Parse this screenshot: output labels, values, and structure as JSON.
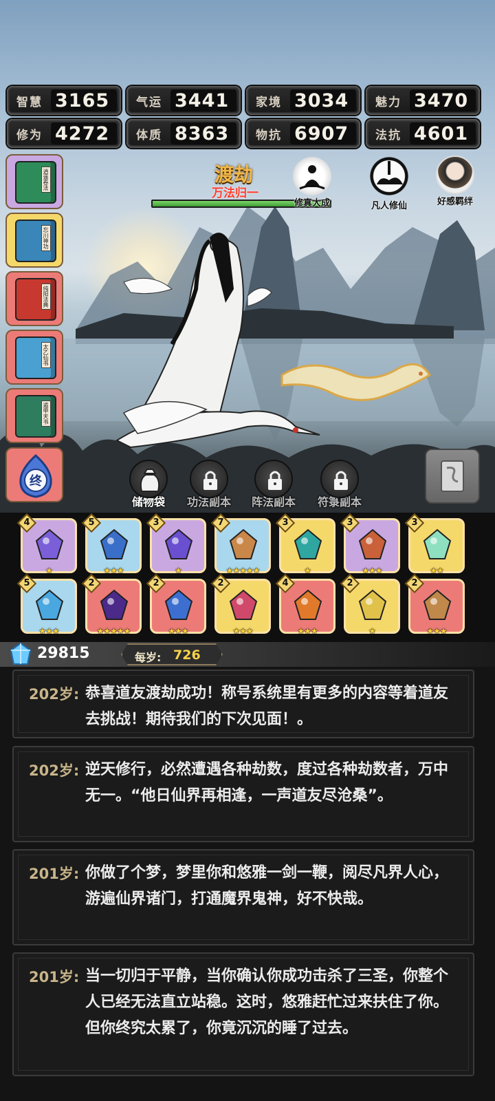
{
  "stats": [
    {
      "label": "智慧",
      "value": "3165"
    },
    {
      "label": "气运",
      "value": "3441"
    },
    {
      "label": "家境",
      "value": "3034"
    },
    {
      "label": "魅力",
      "value": "3470"
    },
    {
      "label": "修为",
      "value": "4272"
    },
    {
      "label": "体质",
      "value": "8363"
    },
    {
      "label": "物抗",
      "value": "6907"
    },
    {
      "label": "法抗",
      "value": "4601"
    }
  ],
  "books": [
    {
      "title": "逍遥卷法",
      "icon": "green-book-icon",
      "bg": "#c9a8e2"
    },
    {
      "title": "忘川神功",
      "icon": "blue-book-icon",
      "bg": "#f5d86a"
    },
    {
      "title": "纯阳法典",
      "icon": "red-book-icon",
      "bg": "#ec7b78"
    },
    {
      "title": "太乙仙书",
      "icon": "blue-book-icon",
      "bg": "#ec7b78"
    },
    {
      "title": "遁甲天书",
      "icon": "green-book-icon",
      "bg": "#ec7b78"
    }
  ],
  "end_icon": {
    "label": "终",
    "icon": "end-flame-icon",
    "bg": "#ec7b78"
  },
  "boss": {
    "name": "渡劫",
    "subtitle": "万法归一",
    "hp_fraction": 1.0
  },
  "top_icons": [
    {
      "label": "修真大成",
      "icon": "meditating-sage-icon"
    },
    {
      "label": "凡人修仙",
      "icon": "immortal-cloud-icon"
    },
    {
      "label": "好感羁绊",
      "icon": "companion-portrait-icon"
    }
  ],
  "tabs": [
    {
      "label": "储物袋",
      "icon": "storage-bag-icon",
      "locked": false
    },
    {
      "label": "功法副本",
      "icon": "lock-icon",
      "locked": true
    },
    {
      "label": "阵法副本",
      "icon": "lock-icon",
      "locked": true
    },
    {
      "label": "符箓副本",
      "icon": "lock-icon",
      "locked": true
    }
  ],
  "scroll_button": {
    "icon": "scroll-icon"
  },
  "inventory": [
    {
      "count": "4",
      "stars": 1,
      "icon": "ring-icon",
      "bg": "#c9a8e2"
    },
    {
      "count": "5",
      "stars": 3,
      "icon": "boots-icon",
      "bg": "#a9d7ee"
    },
    {
      "count": "3",
      "stars": 1,
      "icon": "necklace-icon",
      "bg": "#c9a8e2"
    },
    {
      "count": "7",
      "stars": 5,
      "icon": "sword-icon",
      "bg": "#a9d7ee"
    },
    {
      "count": "3",
      "stars": 1,
      "icon": "jade-sword-icon",
      "bg": "#f5d86a"
    },
    {
      "count": "3",
      "stars": 3,
      "icon": "gourd-icon",
      "bg": "#c9a8e2"
    },
    {
      "count": "3",
      "stars": 2,
      "icon": "crystal-icon",
      "bg": "#f5d86a"
    },
    {
      "count": "5",
      "stars": 3,
      "icon": "ice-armor-icon",
      "bg": "#a9d7ee"
    },
    {
      "count": "2",
      "stars": 5,
      "icon": "mirror-icon",
      "bg": "#ec7b78"
    },
    {
      "count": "2",
      "stars": 3,
      "icon": "dagger-icon",
      "bg": "#ec7b78"
    },
    {
      "count": "2",
      "stars": 3,
      "icon": "phoenix-bowl-icon",
      "bg": "#f5d86a"
    },
    {
      "count": "4",
      "stars": 3,
      "icon": "cauldron-icon",
      "bg": "#ec7b78"
    },
    {
      "count": "2",
      "stars": 1,
      "icon": "golden-staff-icon",
      "bg": "#f5d86a"
    },
    {
      "count": "2",
      "stars": 3,
      "icon": "spear-icon",
      "bg": "#ec7b78"
    }
  ],
  "currency": {
    "icon": "spirit-gem-icon",
    "amount": "29815",
    "rate_label": "每岁:",
    "rate_value": "726"
  },
  "logs": [
    {
      "age": "202岁:",
      "text": "恭喜道友渡劫成功！称号系统里有更多的内容等着道友去挑战！期待我们的下次见面！。"
    },
    {
      "age": "202岁:",
      "text": "逆天修行，必然遭遇各种劫数，度过各种劫数者，万中无一。“他日仙界再相逢，一声道友尽沧桑”。"
    },
    {
      "age": "201岁:",
      "text": "你做了个梦，梦里你和悠雅一剑一鞭，阅尽凡界人心，游遍仙界诸门，打通魔界鬼神，好不快哉。"
    },
    {
      "age": "201岁:",
      "text": "当一切归于平静，当你确认你成功击杀了三圣，你整个人已经无法直立站稳。这时，悠雅赶忙过来扶住了你。但你终究太累了，你竟沉沉的睡了过去。"
    }
  ]
}
